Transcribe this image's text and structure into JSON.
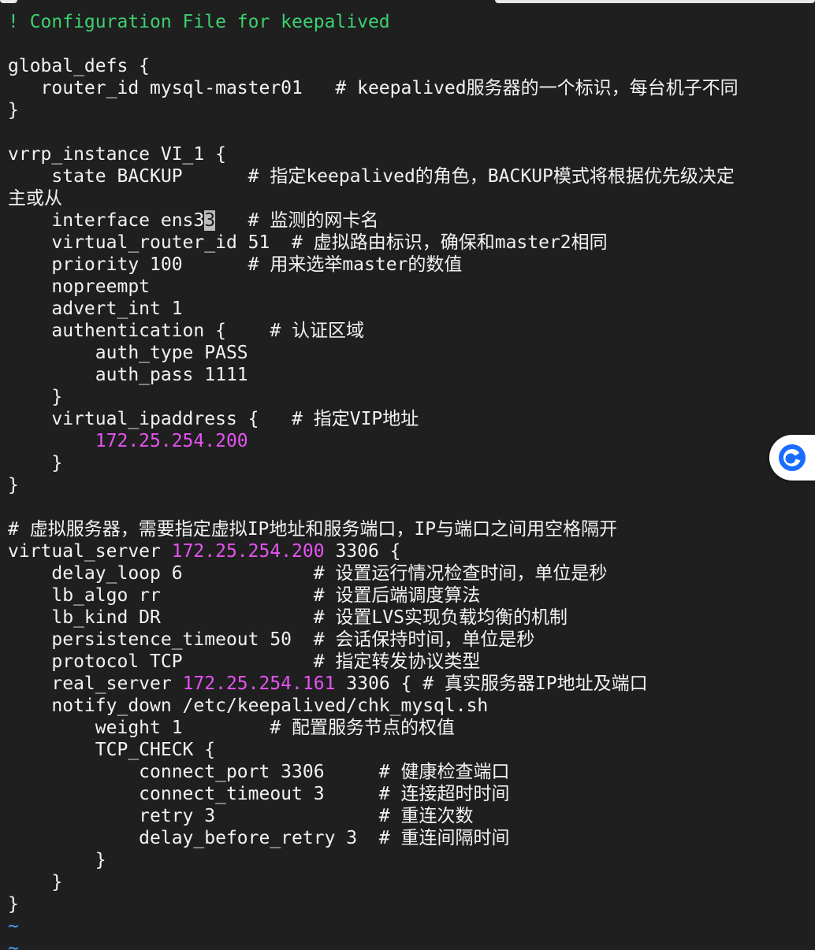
{
  "editor": {
    "lines": [
      {
        "segments": [
          {
            "text": "! Configuration File for keepalived",
            "role": "comment"
          }
        ]
      },
      {
        "segments": [
          {
            "text": "",
            "role": "plain"
          }
        ]
      },
      {
        "segments": [
          {
            "text": "global_defs {",
            "role": "plain"
          }
        ]
      },
      {
        "segments": [
          {
            "text": "   router_id mysql-master01   # keepalived服务器的一个标识，每台机子不同",
            "role": "plain"
          }
        ]
      },
      {
        "segments": [
          {
            "text": "}",
            "role": "plain"
          }
        ]
      },
      {
        "segments": [
          {
            "text": "",
            "role": "plain"
          }
        ]
      },
      {
        "segments": [
          {
            "text": "vrrp_instance VI_1 {",
            "role": "plain"
          }
        ]
      },
      {
        "segments": [
          {
            "text": "    state BACKUP      # 指定keepalived的角色，BACKUP模式将根据优先级决定",
            "role": "plain"
          }
        ]
      },
      {
        "segments": [
          {
            "text": "主或从",
            "role": "plain"
          }
        ]
      },
      {
        "segments": [
          {
            "text": "    interface ens3",
            "role": "plain"
          },
          {
            "text": "3",
            "role": "cursor"
          },
          {
            "text": "   # 监测的网卡名",
            "role": "plain"
          }
        ]
      },
      {
        "segments": [
          {
            "text": "    virtual_router_id 51  # 虚拟路由标识，确保和master2相同",
            "role": "plain"
          }
        ]
      },
      {
        "segments": [
          {
            "text": "    priority 100      # 用来选举master的数值",
            "role": "plain"
          }
        ]
      },
      {
        "segments": [
          {
            "text": "    nopreempt",
            "role": "plain"
          }
        ]
      },
      {
        "segments": [
          {
            "text": "    advert_int 1",
            "role": "plain"
          }
        ]
      },
      {
        "segments": [
          {
            "text": "    authentication {    # 认证区域",
            "role": "plain"
          }
        ]
      },
      {
        "segments": [
          {
            "text": "        auth_type PASS",
            "role": "plain"
          }
        ]
      },
      {
        "segments": [
          {
            "text": "        auth_pass 1111",
            "role": "plain"
          }
        ]
      },
      {
        "segments": [
          {
            "text": "    }",
            "role": "plain"
          }
        ]
      },
      {
        "segments": [
          {
            "text": "    virtual_ipaddress {   # 指定VIP地址",
            "role": "plain"
          }
        ]
      },
      {
        "segments": [
          {
            "text": "        ",
            "role": "plain"
          },
          {
            "text": "172.25.254.200",
            "role": "ip"
          }
        ]
      },
      {
        "segments": [
          {
            "text": "    }",
            "role": "plain"
          }
        ]
      },
      {
        "segments": [
          {
            "text": "}",
            "role": "plain"
          }
        ]
      },
      {
        "segments": [
          {
            "text": "",
            "role": "plain"
          }
        ]
      },
      {
        "segments": [
          {
            "text": "# 虚拟服务器，需要指定虚拟IP地址和服务端口，IP与端口之间用空格隔开",
            "role": "plain"
          }
        ]
      },
      {
        "segments": [
          {
            "text": "virtual_server ",
            "role": "plain"
          },
          {
            "text": "172.25.254.200",
            "role": "ip"
          },
          {
            "text": " 3306 {",
            "role": "plain"
          }
        ]
      },
      {
        "segments": [
          {
            "text": "    delay_loop 6            # 设置运行情况检查时间，单位是秒",
            "role": "plain"
          }
        ]
      },
      {
        "segments": [
          {
            "text": "    lb_algo rr              # 设置后端调度算法",
            "role": "plain"
          }
        ]
      },
      {
        "segments": [
          {
            "text": "    lb_kind DR              # 设置LVS实现负载均衡的机制",
            "role": "plain"
          }
        ]
      },
      {
        "segments": [
          {
            "text": "    persistence_timeout 50  # 会话保持时间，单位是秒",
            "role": "plain"
          }
        ]
      },
      {
        "segments": [
          {
            "text": "    protocol TCP            # 指定转发协议类型",
            "role": "plain"
          }
        ]
      },
      {
        "segments": [
          {
            "text": "    real_server ",
            "role": "plain"
          },
          {
            "text": "172.25.254.161",
            "role": "ip"
          },
          {
            "text": " 3306 { # 真实服务器IP地址及端口",
            "role": "plain"
          }
        ]
      },
      {
        "segments": [
          {
            "text": "    notify_down /etc/keepalived/chk_mysql.sh",
            "role": "plain"
          }
        ]
      },
      {
        "segments": [
          {
            "text": "        weight 1        # 配置服务节点的权值",
            "role": "plain"
          }
        ]
      },
      {
        "segments": [
          {
            "text": "        TCP_CHECK {",
            "role": "plain"
          }
        ]
      },
      {
        "segments": [
          {
            "text": "            connect_port 3306     # 健康检查端口",
            "role": "plain"
          }
        ]
      },
      {
        "segments": [
          {
            "text": "            connect_timeout 3     # 连接超时时间",
            "role": "plain"
          }
        ]
      },
      {
        "segments": [
          {
            "text": "            retry 3               # 重连次数",
            "role": "plain"
          }
        ]
      },
      {
        "segments": [
          {
            "text": "            delay_before_retry 3  # 重连间隔时间",
            "role": "plain"
          }
        ]
      },
      {
        "segments": [
          {
            "text": "        }",
            "role": "plain"
          }
        ]
      },
      {
        "segments": [
          {
            "text": "    }",
            "role": "plain"
          }
        ]
      },
      {
        "segments": [
          {
            "text": "}",
            "role": "plain"
          }
        ]
      },
      {
        "segments": [
          {
            "text": "~",
            "role": "tilde"
          }
        ]
      },
      {
        "segments": [
          {
            "text": "~",
            "role": "tilde"
          }
        ]
      }
    ]
  },
  "colors": {
    "background": "#1f1f1f",
    "text": "#f2f2f2",
    "comment": "#3cd06f",
    "ip_literal": "#e653f2",
    "tilde": "#4aa3ff",
    "cursor": "#bdbdbd",
    "float_button_accent": "#1a6cff"
  },
  "float_button": {
    "icon": "assistant-chat-icon"
  }
}
